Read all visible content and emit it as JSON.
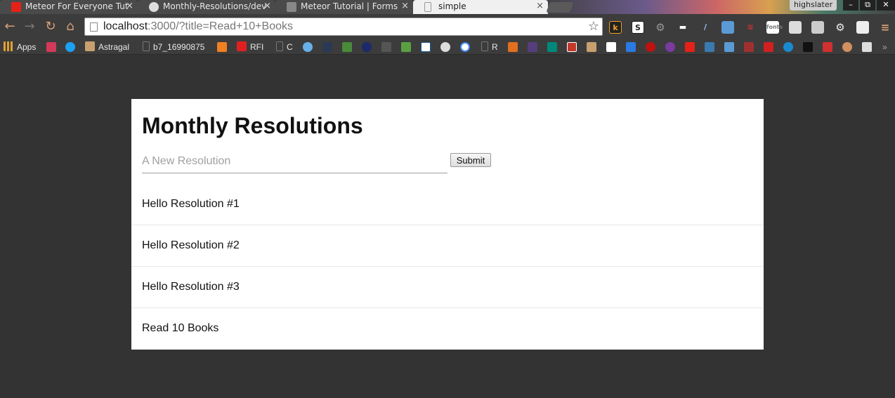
{
  "tabs": [
    {
      "title": "Meteor For Everyone Tut",
      "favicon": "youtube-icon",
      "color": "#e62117"
    },
    {
      "title": "Monthly-Resolutions/dev",
      "favicon": "github-icon",
      "color": "#dddddd"
    },
    {
      "title": "Meteor Tutorial | Forms",
      "favicon": "meteor-icon",
      "color": "#888888"
    },
    {
      "title": "simple",
      "favicon": "page-icon",
      "color": "#bbbbbb",
      "active": true
    }
  ],
  "window": {
    "user": "highslater",
    "minimize": "–",
    "restore": "⧉",
    "close": "✕"
  },
  "toolbar": {
    "back": "←",
    "forward": "→",
    "reload": "↻",
    "home": "⌂",
    "url_host": "localhost",
    "url_rest": ":3000/?title=Read+10+Books",
    "star": "☆"
  },
  "bookmarks": [
    {
      "label": "Apps",
      "icon": "apps-grid-icon",
      "color": "#e0a030"
    },
    {
      "label": "",
      "icon": "lastpass-icon",
      "color": "#d33a5a"
    },
    {
      "label": "",
      "icon": "twitter-icon",
      "color": "#1da1f2"
    },
    {
      "label": "Astragal",
      "icon": "astragal-icon",
      "color": "#c8a070"
    },
    {
      "label": "b7_16990875",
      "icon": "page-icon",
      "color": "#555555"
    },
    {
      "label": "",
      "icon": "chart-icon",
      "color": "#f08020"
    },
    {
      "label": "RFI",
      "icon": "rfi-icon",
      "color": "#e02020"
    },
    {
      "label": "C",
      "icon": "page-icon",
      "color": "#555555"
    },
    {
      "label": "R",
      "icon": "page-icon",
      "color": "#555555"
    }
  ],
  "colors": {
    "background": "#333333",
    "card": "#ffffff",
    "accent": "#d8a078"
  },
  "main": {
    "title": "Monthly Resolutions",
    "input_placeholder": "A New Resolution",
    "submit_label": "Submit",
    "resolutions": [
      "Hello Resolution #1",
      "Hello Resolution #2",
      "Hello Resolution #3",
      "Read 10 Books"
    ]
  }
}
